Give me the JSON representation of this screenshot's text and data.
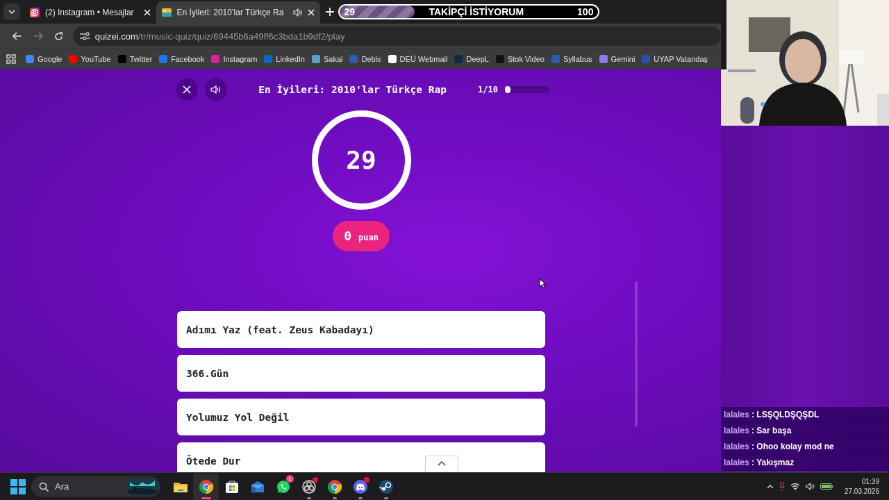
{
  "browser": {
    "tabs": [
      {
        "title": "(2) Instagram • Mesajlar",
        "selected": false,
        "audio": false,
        "kind": "instagram"
      },
      {
        "title": "En İyileri: 2010’lar Türkçe Ra",
        "selected": true,
        "audio": true,
        "kind": "quiz"
      }
    ],
    "follower_goal": {
      "current": "29",
      "title": "TAKİPÇİ İSTİYORUM",
      "target": "100",
      "level": 0.29
    },
    "address": {
      "domain": "quizei.com",
      "path": "/tr/music-quiz/quiz/69445b6a49ff6c3bda1b9df2/play"
    },
    "bookmarks": [
      {
        "label": "Google",
        "color": "#4285f4"
      },
      {
        "label": "YouTube",
        "color": "#ff0000"
      },
      {
        "label": "Twitter",
        "color": "#000000"
      },
      {
        "label": "Facebook",
        "color": "#1877f2"
      },
      {
        "label": "Instagram",
        "color": "#d6249f"
      },
      {
        "label": "LinkedIn",
        "color": "#0a66c2"
      },
      {
        "label": "Sakai",
        "color": "#5aa0c8"
      },
      {
        "label": "Debis",
        "color": "#2a5db0"
      },
      {
        "label": "DEÜ Webmail",
        "color": "#ffffff"
      },
      {
        "label": "DeepL",
        "color": "#0f2b46"
      },
      {
        "label": "Stok Video",
        "color": "#111111"
      },
      {
        "label": "Syllabus",
        "color": "#2a5db0"
      },
      {
        "label": "Gemini",
        "color": "#8a7cf0"
      },
      {
        "label": "UYAP Vatandaş",
        "color": "#2b4bb5"
      }
    ]
  },
  "quiz": {
    "title": "En İyileri: 2010'lar Türkçe Rap",
    "progress_text": "1/10",
    "level": 0.1,
    "timer": "29",
    "score": {
      "value": "0",
      "unit": "puan"
    },
    "options": [
      "Adımı Yaz (feat. Zeus Kabadayı)",
      "366.Gün",
      "Yolumuz Yol Değil",
      "Ötede Dur"
    ]
  },
  "chat": [
    {
      "user": "lalales",
      "separator": ":",
      "message": "LSŞQLDŞQŞDL"
    },
    {
      "user": "lalales",
      "separator": ":",
      "message": "Sar başa"
    },
    {
      "user": "lalales",
      "separator": ":",
      "message": "Ohoo kolay mod ne"
    },
    {
      "user": "lalales",
      "separator": ":",
      "message": "Yakışmaz"
    }
  ],
  "taskbar": {
    "search_placeholder": "Ara",
    "apps": [
      {
        "kind": "folder",
        "active": false,
        "running": false,
        "notification": false
      },
      {
        "kind": "chrome",
        "active": true,
        "running": true,
        "notification": false
      },
      {
        "kind": "store",
        "active": false,
        "running": false,
        "notification": false
      },
      {
        "kind": "mail",
        "active": false,
        "running": false,
        "notification": false
      },
      {
        "kind": "whatsapp",
        "active": false,
        "running": false,
        "notification": false,
        "badge": "1"
      },
      {
        "kind": "obs",
        "active": false,
        "running": true,
        "notification": true
      },
      {
        "kind": "chrome",
        "active": false,
        "running": true,
        "notification": false
      },
      {
        "kind": "discord",
        "active": false,
        "running": true,
        "notification": true
      },
      {
        "kind": "steam",
        "active": false,
        "running": true,
        "notification": false
      }
    ],
    "time": "01:39",
    "date": "27.03.2026"
  }
}
